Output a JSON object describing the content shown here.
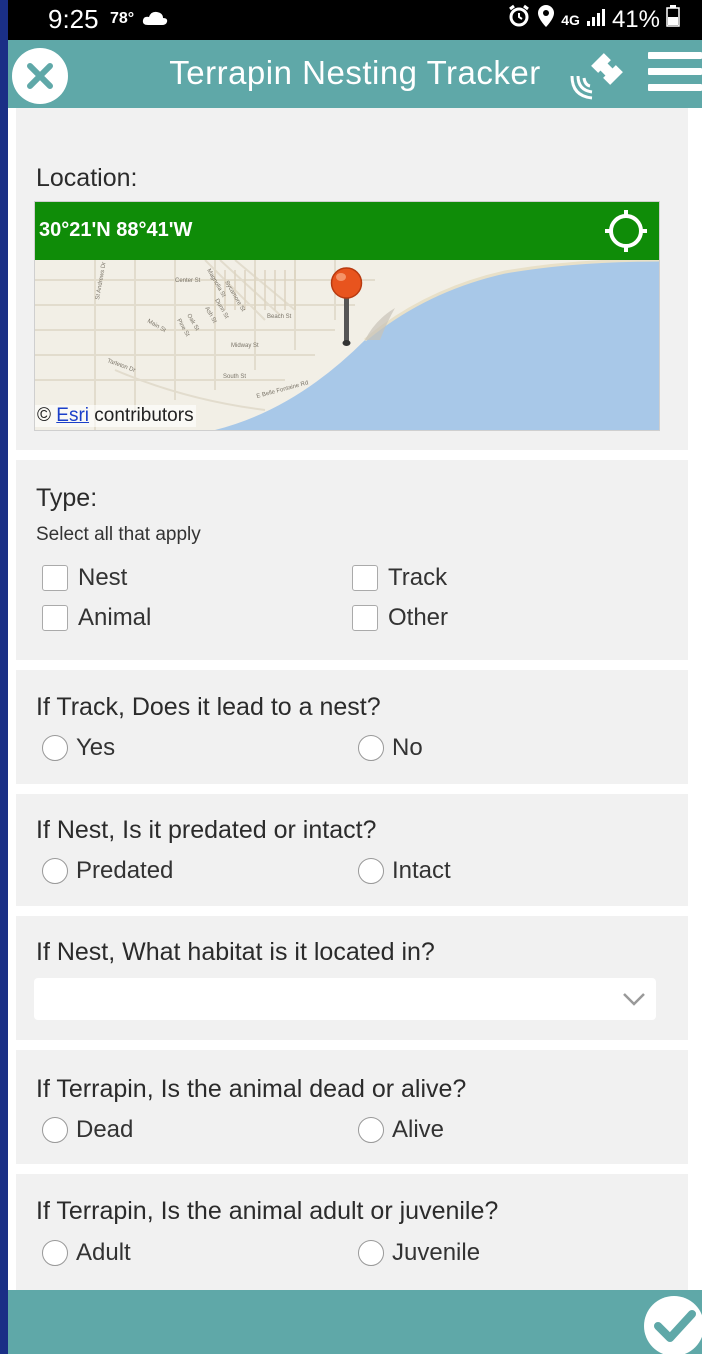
{
  "status_bar": {
    "time": "9:25",
    "temp": "78°",
    "network": "4G",
    "battery": "41%"
  },
  "header": {
    "title": "Terrapin Nesting Tracker"
  },
  "location": {
    "label": "Location:",
    "coordinates": "30°21'N 88°41'W",
    "attribution_symbol": "©",
    "attribution_link": "Esri",
    "attribution_text": "contributors",
    "streets": [
      "Center St",
      "Magnolia St",
      "Sycamore St",
      "Dunn St",
      "Ash St",
      "Oak St",
      "Pine St",
      "Beach St",
      "Main St",
      "St Andrews Dr",
      "Midway St",
      "South St",
      "Tarleton Dr",
      "E Belle Fontaine Rd"
    ]
  },
  "type": {
    "label": "Type:",
    "hint": "Select all that apply",
    "options": [
      "Nest",
      "Track",
      "Animal",
      "Other"
    ]
  },
  "track_question": {
    "label": "If Track, Does it lead to a nest?",
    "options": [
      "Yes",
      "No"
    ]
  },
  "nest_question": {
    "label": "If Nest, Is it predated or intact?",
    "options": [
      "Predated",
      "Intact"
    ]
  },
  "habitat_question": {
    "label": "If Nest, What habitat is it located in?",
    "value": ""
  },
  "dead_question": {
    "label": "If Terrapin, Is the animal dead or alive?",
    "options": [
      "Dead",
      "Alive"
    ]
  },
  "age_question": {
    "label": "If Terrapin, Is the animal adult or juvenile?",
    "options": [
      "Adult",
      "Juvenile"
    ]
  },
  "colors": {
    "accent": "#5fa8a8",
    "coord_bar": "#0f8c08",
    "pin": "#e8541e",
    "water": "#a8c8e8"
  }
}
